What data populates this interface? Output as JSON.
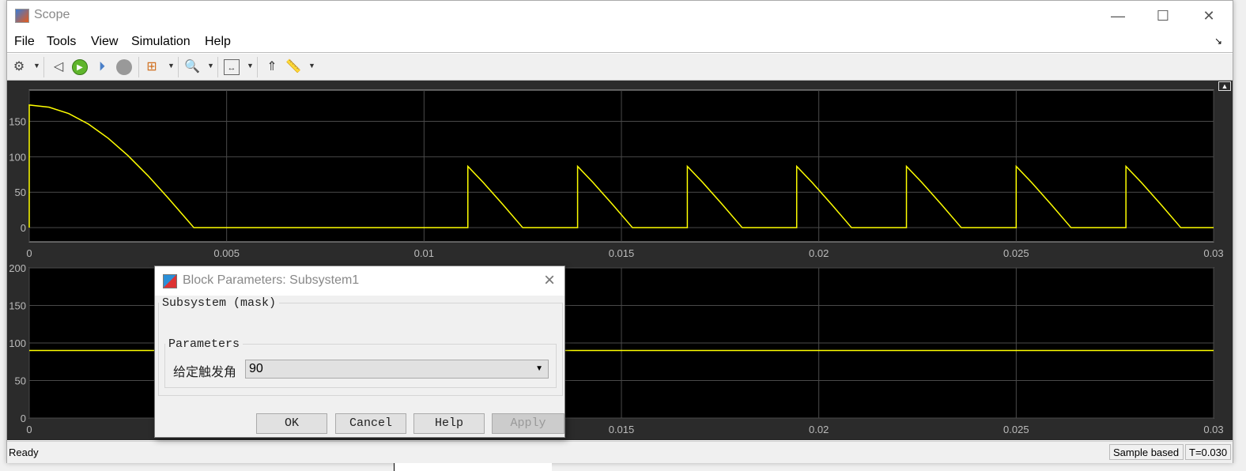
{
  "window": {
    "title": "Scope",
    "minimize": "—",
    "maximize": "☐",
    "close": "✕"
  },
  "menu": [
    "File",
    "Tools",
    "View",
    "Simulation",
    "Help"
  ],
  "toolbar": {
    "icons": [
      "gear-icon",
      "step-back-icon",
      "run-icon",
      "step-forward-icon",
      "stop-icon",
      "signal-hierarchy-icon",
      "zoom-in-icon",
      "scale-axes-icon",
      "triggers-icon",
      "measurements-icon"
    ]
  },
  "status": {
    "text": "Ready",
    "mode": "Sample based",
    "time": "T=0.030"
  },
  "dialog": {
    "title": "Block Parameters: Subsystem1",
    "group": "Subsystem (mask)",
    "params_group": "Parameters",
    "param_label": "给定触发角",
    "param_value": "90",
    "buttons": {
      "ok": "OK",
      "cancel": "Cancel",
      "help": "Help",
      "apply": "Apply"
    }
  },
  "colors": {
    "trace": "#ffff00",
    "axes_bg": "#000000",
    "figure_bg": "#2b2b2b",
    "grid": "#4a4a4a"
  },
  "chart_data": [
    {
      "type": "line",
      "xlim": [
        0,
        0.03
      ],
      "ylim": [
        -20,
        194
      ],
      "grid": true,
      "xticks": [
        "0",
        "0.005",
        "0.01",
        "0.015",
        "0.02",
        "0.025",
        "0.03"
      ],
      "xtick_values": [
        0,
        0.005,
        0.01,
        0.015,
        0.02,
        0.025,
        0.03
      ],
      "yticks": [
        "0",
        "50",
        "100",
        "150"
      ],
      "ytick_values": [
        0,
        50,
        100,
        150
      ],
      "series": [
        {
          "color": "#ffff00",
          "points": [
            [
              0,
              0
            ],
            [
              0,
              173
            ],
            [
              0.0005,
              169.9
            ],
            [
              0.001,
              160.9
            ],
            [
              0.0015,
              146.1
            ],
            [
              0.002,
              126.1
            ],
            [
              0.0025,
              101.7
            ],
            [
              0.003,
              73.7
            ],
            [
              0.0035,
              43
            ],
            [
              0.004,
              10.9
            ],
            [
              0.00417,
              0
            ],
            [
              0.01111,
              0
            ],
            [
              0.01111,
              86.5
            ],
            [
              0.0115,
              63.7
            ],
            [
              0.012,
              32.4
            ],
            [
              0.0125,
              0
            ],
            [
              0.01389,
              0
            ],
            [
              0.01389,
              86.5
            ],
            [
              0.01428,
              63.7
            ],
            [
              0.01478,
              32.4
            ],
            [
              0.01528,
              0
            ],
            [
              0.01667,
              0
            ],
            [
              0.01667,
              86.5
            ],
            [
              0.01706,
              63.7
            ],
            [
              0.01756,
              32.4
            ],
            [
              0.01806,
              0
            ],
            [
              0.01944,
              0
            ],
            [
              0.01944,
              86.5
            ],
            [
              0.01983,
              63.7
            ],
            [
              0.02033,
              32.4
            ],
            [
              0.02083,
              0
            ],
            [
              0.02222,
              0
            ],
            [
              0.02222,
              86.5
            ],
            [
              0.02261,
              63.7
            ],
            [
              0.02311,
              32.4
            ],
            [
              0.02361,
              0
            ],
            [
              0.025,
              0
            ],
            [
              0.025,
              86.5
            ],
            [
              0.02539,
              63.7
            ],
            [
              0.02589,
              32.4
            ],
            [
              0.02639,
              0
            ],
            [
              0.02778,
              0
            ],
            [
              0.02778,
              86.5
            ],
            [
              0.02817,
              63.7
            ],
            [
              0.02867,
              32.4
            ],
            [
              0.02917,
              0
            ],
            [
              0.03,
              0
            ]
          ]
        }
      ]
    },
    {
      "type": "line",
      "xlim": [
        0,
        0.03
      ],
      "ylim": [
        0,
        200
      ],
      "grid": true,
      "xticks": [
        "0",
        "0.005",
        "0.01",
        "0.015",
        "0.02",
        "0.025",
        "0.03"
      ],
      "xtick_values": [
        0,
        0.005,
        0.01,
        0.015,
        0.02,
        0.025,
        0.03
      ],
      "yticks": [
        "0",
        "50",
        "100",
        "150",
        "200"
      ],
      "ytick_values": [
        0,
        50,
        100,
        150,
        200
      ],
      "series": [
        {
          "color": "#ffff00",
          "points": [
            [
              0,
              90
            ],
            [
              0.03,
              90
            ]
          ]
        }
      ]
    }
  ]
}
